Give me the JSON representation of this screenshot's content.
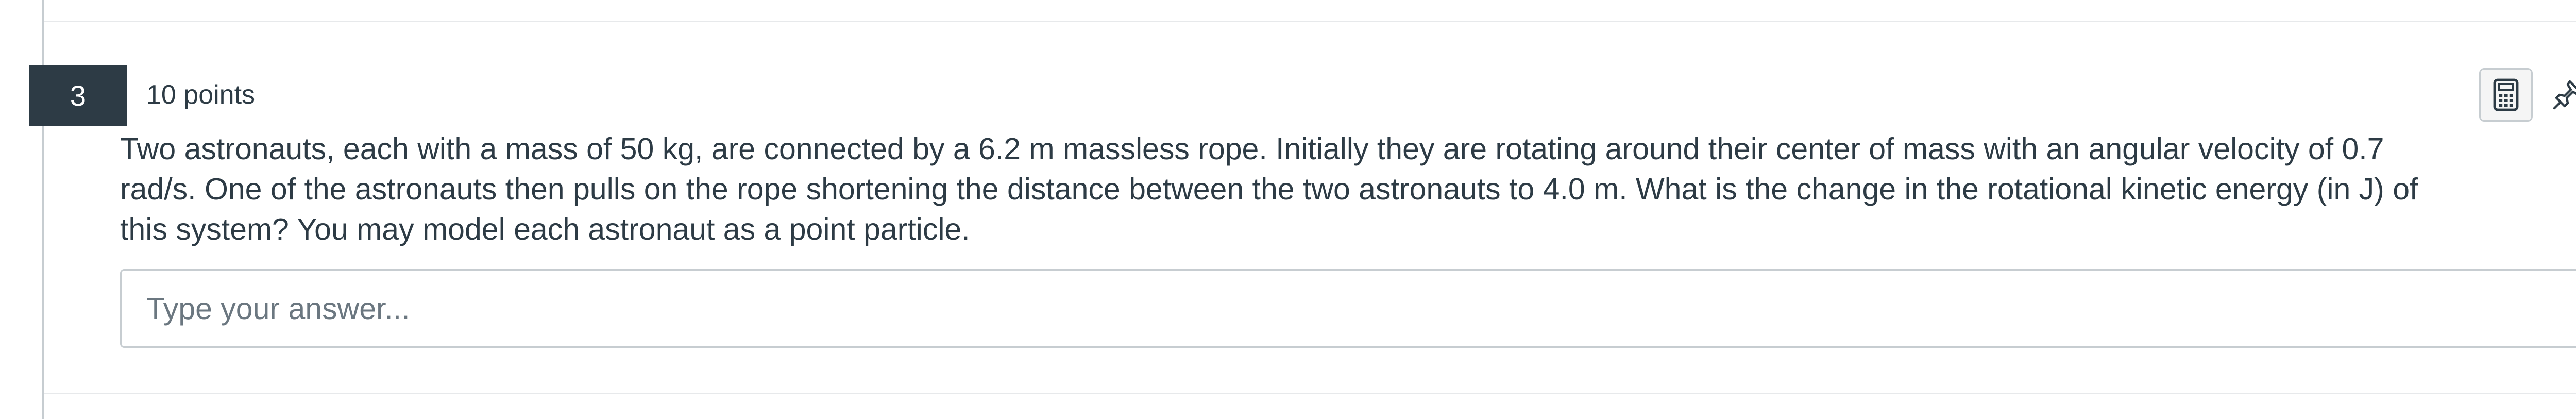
{
  "question": {
    "number": "3",
    "points": "10 points",
    "text": "Two astronauts, each with a mass of 50 kg, are connected by a 6.2 m massless rope.  Initially they are rotating around their center of mass with an angular velocity of 0.7\nrad/s.  One of the astronauts then pulls on the rope shortening the distance between the two astronauts to 4.0 m.  What is the change in the rotational kinetic energy (in J) of\nthis system?  You may model each astronaut as a point particle.",
    "answer_value": "",
    "answer_placeholder": "Type your answer..."
  },
  "toolbar": {
    "calculator_icon": "calculator-icon",
    "pin_icon": "pin-icon"
  },
  "colors": {
    "number_badge_bg": "#2d3b45",
    "text": "#2d3b45",
    "border": "#c7cdd1",
    "placeholder": "#6b7780"
  }
}
